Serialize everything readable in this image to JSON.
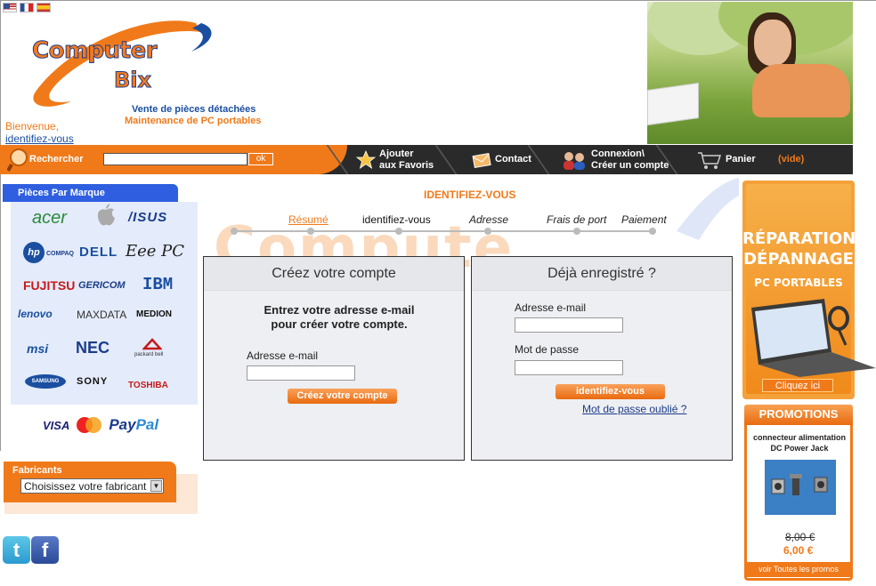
{
  "header": {
    "logo_line1": "Computer",
    "logo_line2": "Bix",
    "tagline1": "Vente de pièces détachées",
    "tagline2": "Maintenance de PC portables",
    "welcome": "Bienvenue,",
    "identify_link": "identifiez-vous"
  },
  "nav": {
    "search_label": "Rechercher",
    "search_value": "",
    "search_button": "ok",
    "favoris_line1": "Ajouter",
    "favoris_line2": "aux Favoris",
    "contact": "Contact",
    "connexion_line1": "Connexion\\",
    "connexion_line2": "Créer un compte",
    "panier": "Panier",
    "panier_status": "(vide)"
  },
  "sidebar": {
    "brands_title": "Pièces Par Marque",
    "brands": [
      "acer",
      "",
      "/ISUS",
      "COMPAQ",
      "DELL",
      "Eee PC",
      "FUJITSU",
      "GERICOM",
      "IBM",
      "lenovo",
      "MAXDATA",
      "MEDION",
      "msi",
      "NEC",
      "packard bell",
      "SAMSUNG",
      "SONY",
      "TOSHIBA"
    ],
    "payments": {
      "visa": "VISA",
      "mastercard": "MasterCard",
      "paypal_a": "Pay",
      "paypal_b": "Pal"
    },
    "fabricants_title": "Fabricants",
    "fabricants_select": "Choisissez votre fabricant"
  },
  "main": {
    "watermark": "Compute",
    "title": "IDENTIFIEZ-VOUS",
    "steps": [
      "Résumé",
      "identifiez-vous",
      "Adresse",
      "Frais de port",
      "Paiement"
    ],
    "create": {
      "title": "Créez votre compte",
      "intro": "Entrez votre adresse e-mail pour créer votre compte.",
      "email_label": "Adresse e-mail",
      "email_value": "",
      "button": "Créez votre compte"
    },
    "login": {
      "title": "Déjà enregistré ?",
      "email_label": "Adresse e-mail",
      "email_value": "",
      "password_label": "Mot de passe",
      "password_value": "",
      "button": "identifiez-vous",
      "forgot": "Mot de passe oublié ?"
    }
  },
  "right": {
    "repair_line1": "RÉPARATION",
    "repair_line2": "DÉPANNAGE",
    "repair_line3": "PC PORTABLES",
    "repair_cta": "Cliquez ici",
    "promo_title": "PROMOTIONS",
    "promo_product": "connecteur alimentation DC Power Jack",
    "promo_old_price": "8,00 €",
    "promo_new_price": "6,00 €",
    "promo_footer": "voir Toutes les promos"
  },
  "colors": {
    "orange": "#f07a1a",
    "blue": "#1a4fa0",
    "dark": "#2a2a2a"
  }
}
